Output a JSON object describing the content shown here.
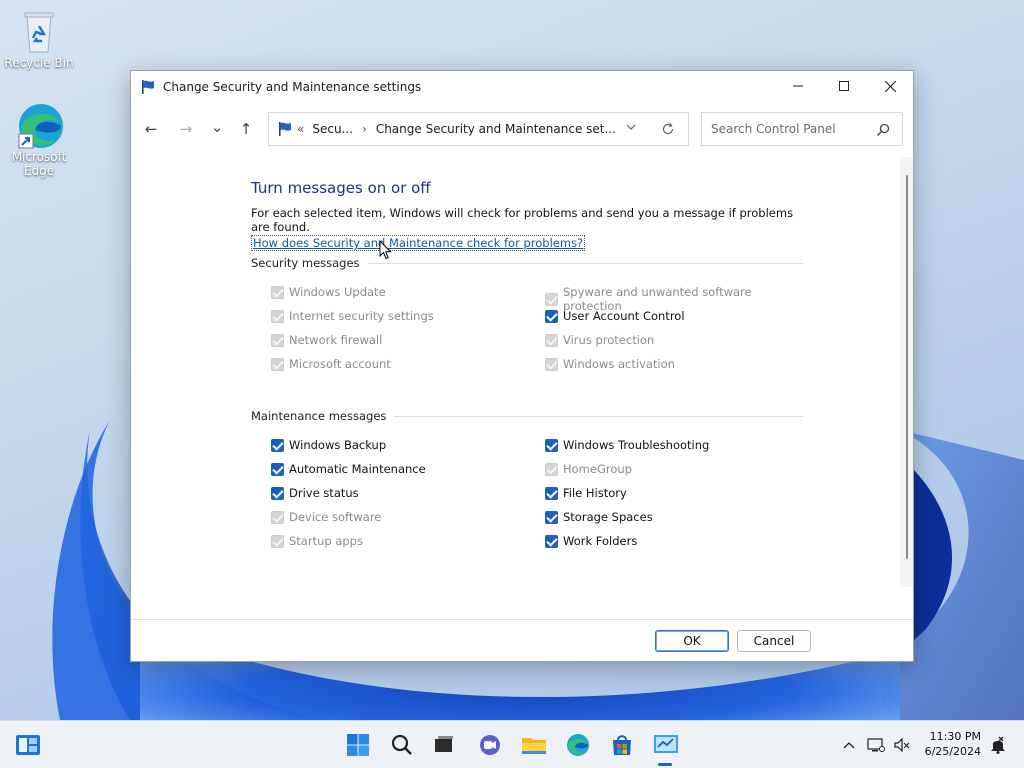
{
  "desktop": {
    "icons": [
      {
        "label": "Recycle Bin",
        "icon": "recycle-bin-icon"
      },
      {
        "label": "Microsoft Edge",
        "icon": "edge-icon"
      }
    ]
  },
  "window": {
    "title": "Change Security and Maintenance settings",
    "nav": {
      "back": "←",
      "forward": "→",
      "recent": "⌄",
      "up": "↑"
    },
    "address": {
      "overflow": "«",
      "crumb1": "Secu...",
      "separator": "›",
      "crumb2": "Change Security and Maintenance set..."
    },
    "search": {
      "placeholder": "Search Control Panel"
    },
    "heading": "Turn messages on or off",
    "intro": "For each selected item, Windows will check for problems and send you a message if problems are found.",
    "help_link": "How does Security and Maintenance check for problems?",
    "security_section": {
      "title": "Security messages",
      "items": [
        {
          "label": "Windows Update",
          "checked": true,
          "enabled": false
        },
        {
          "label": "Spyware and unwanted software protection",
          "checked": true,
          "enabled": false
        },
        {
          "label": "Internet security settings",
          "checked": true,
          "enabled": false
        },
        {
          "label": "User Account Control",
          "checked": true,
          "enabled": true
        },
        {
          "label": "Network firewall",
          "checked": true,
          "enabled": false
        },
        {
          "label": "Virus protection",
          "checked": true,
          "enabled": false
        },
        {
          "label": "Microsoft account",
          "checked": true,
          "enabled": false
        },
        {
          "label": "Windows activation",
          "checked": true,
          "enabled": false
        }
      ]
    },
    "maintenance_section": {
      "title": "Maintenance messages",
      "items": [
        {
          "label": "Windows Backup",
          "checked": true,
          "enabled": true
        },
        {
          "label": "Windows Troubleshooting",
          "checked": true,
          "enabled": true
        },
        {
          "label": "Automatic Maintenance",
          "checked": true,
          "enabled": true
        },
        {
          "label": "HomeGroup",
          "checked": true,
          "enabled": false
        },
        {
          "label": "Drive status",
          "checked": true,
          "enabled": true
        },
        {
          "label": "File History",
          "checked": true,
          "enabled": true
        },
        {
          "label": "Device software",
          "checked": true,
          "enabled": false
        },
        {
          "label": "Storage Spaces",
          "checked": true,
          "enabled": true
        },
        {
          "label": "Startup apps",
          "checked": true,
          "enabled": false
        },
        {
          "label": "Work Folders",
          "checked": true,
          "enabled": true
        }
      ]
    },
    "buttons": {
      "ok": "OK",
      "cancel": "Cancel"
    }
  },
  "taskbar": {
    "apps": [
      "start-icon",
      "search-icon",
      "task-view-icon",
      "chat-icon",
      "file-explorer-icon",
      "edge-icon",
      "store-icon",
      "control-panel-icon"
    ],
    "clock": {
      "time": "11:30 PM",
      "date": "6/25/2024"
    }
  },
  "colors": {
    "accent": "#1f5fbd",
    "heading": "#1e3287",
    "link": "#0a5ba8"
  }
}
